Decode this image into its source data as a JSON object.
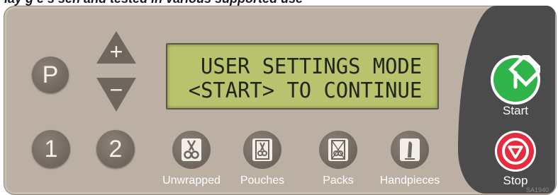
{
  "caption": "lay g e s sen and tested in various supported use",
  "display": {
    "line1": "USER SETTINGS MODE",
    "line2": "<START> TO CONTINUE"
  },
  "buttons": {
    "program": "P",
    "user1": "1",
    "user2": "2",
    "increase": "+",
    "decrease": "−"
  },
  "cycles": [
    {
      "label": "Unwrapped",
      "icon": "unwrapped-icon"
    },
    {
      "label": "Pouches",
      "icon": "pouches-icon"
    },
    {
      "label": "Packs",
      "icon": "packs-icon"
    },
    {
      "label": "Handpieces",
      "icon": "handpieces-icon"
    }
  ],
  "start": {
    "label": "Start",
    "icon": "power-icon",
    "color": "#2fb34a"
  },
  "stop": {
    "label": "Stop",
    "icon": "stop-triangle-icon",
    "color": "#e52d3f"
  },
  "code": "SA1940",
  "colors": {
    "panel": "#bcb0a4",
    "lcd": "#b9c36d",
    "button": "#6f665d",
    "right_panel": "#4b4b4b"
  }
}
